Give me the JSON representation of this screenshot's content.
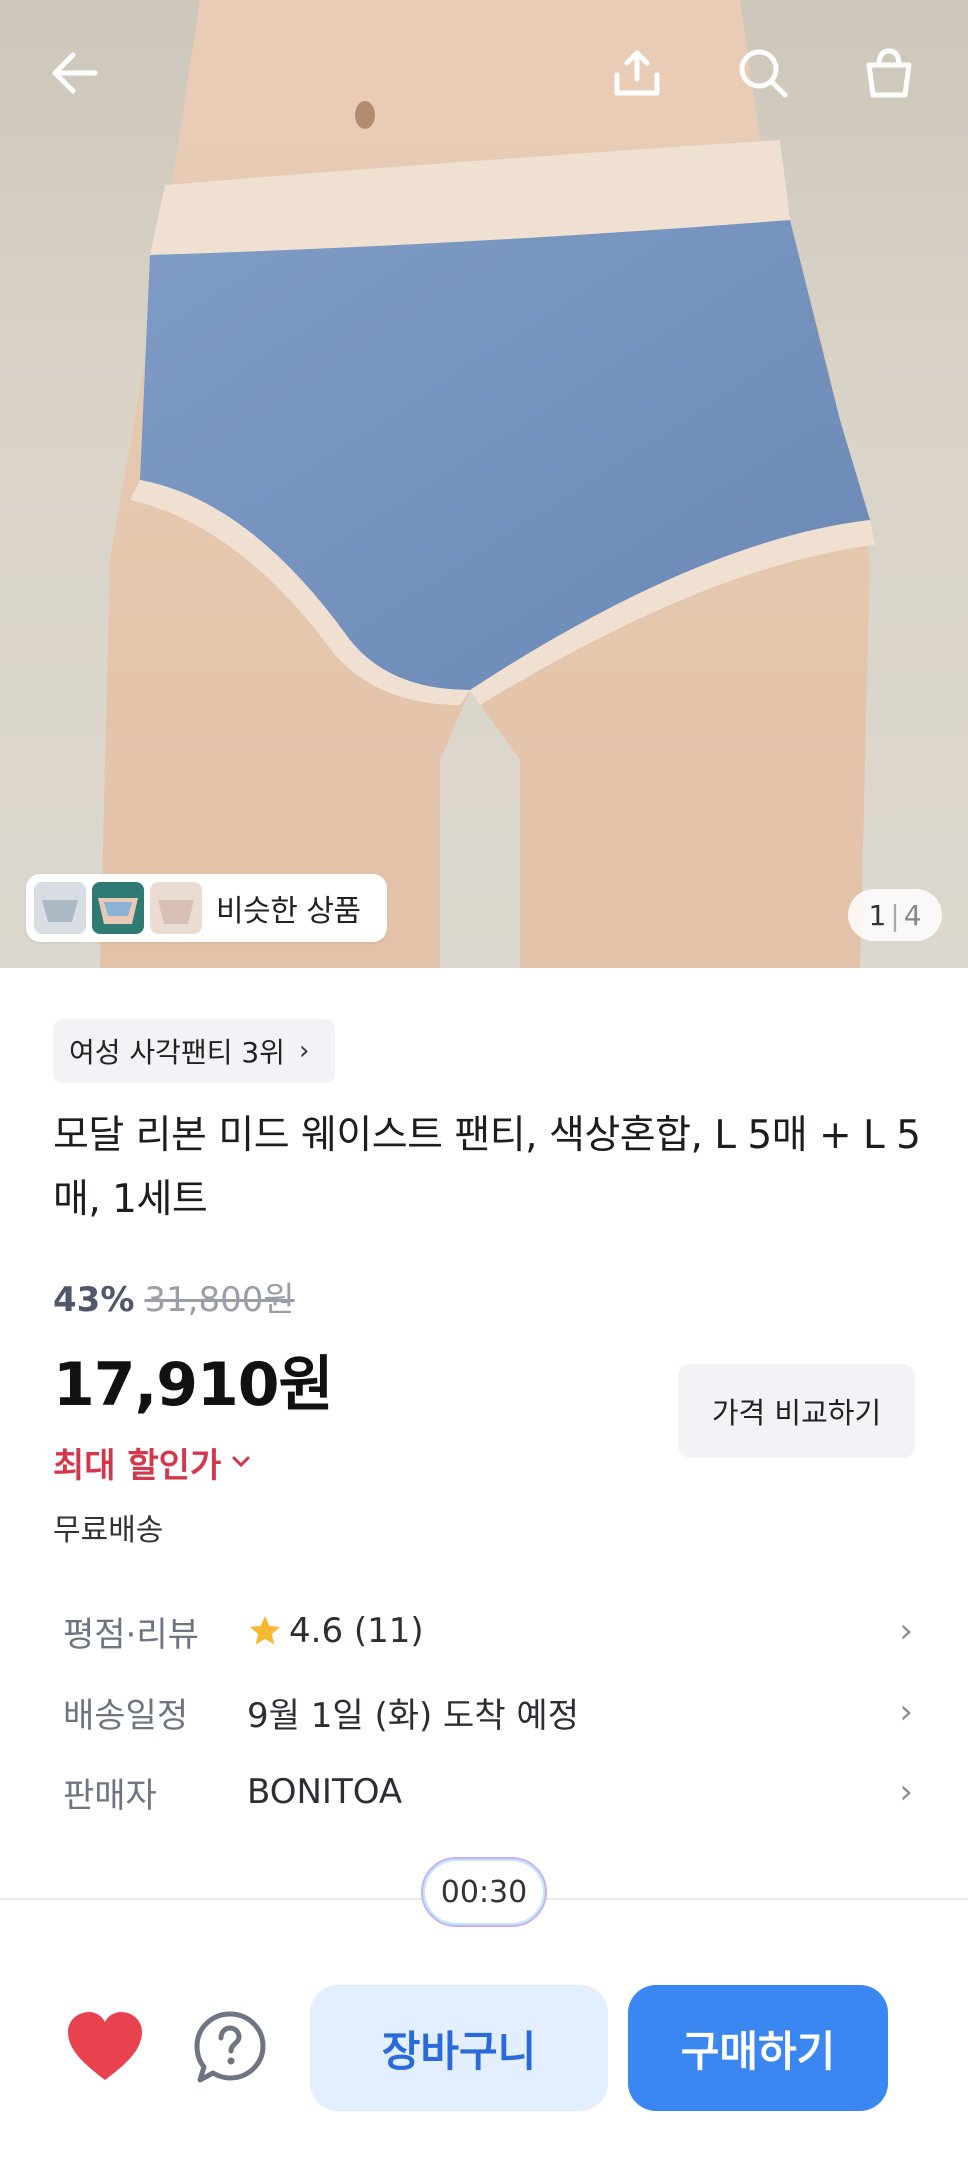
{
  "header": {
    "back_icon": "arrow-left-icon",
    "share_icon": "share-upload-icon",
    "search_icon": "search-icon",
    "cart_icon": "shopping-bag-icon"
  },
  "gallery": {
    "similar_label": "비슷한 상품",
    "current_page": "1",
    "page_separator": "|",
    "total_pages": "4"
  },
  "product": {
    "rank_label": "여성 사각팬티 3위",
    "title": "모달 리본 미드 웨이스트 팬티, 색상혼합, L 5매 + L 5매, 1세트",
    "discount_percent": "43%",
    "original_price": "31,800원",
    "sale_price": "17,910원",
    "compare_label": "가격 비교하기",
    "max_discount_label": "최대 할인가",
    "shipping_label": "무료배송"
  },
  "info": {
    "rows": [
      {
        "key": "평점·리뷰",
        "value": "4.6 (11)"
      },
      {
        "key": "배송일정",
        "value": "9월 1일 (화) 도착 예정"
      },
      {
        "key": "판매자",
        "value": "BONITOA"
      }
    ]
  },
  "timer": {
    "label": "00:30"
  },
  "bottom": {
    "favorite_icon": "heart-icon",
    "help_icon": "question-bubble-icon",
    "cart_label": "장바구니",
    "buy_label": "구매하기"
  },
  "colors": {
    "accent_blue": "#3a87f2",
    "cart_bg": "#e3efff",
    "discount_red": "#d4364a",
    "heart_red": "#e8424f",
    "star_yellow": "#f5b82e"
  }
}
